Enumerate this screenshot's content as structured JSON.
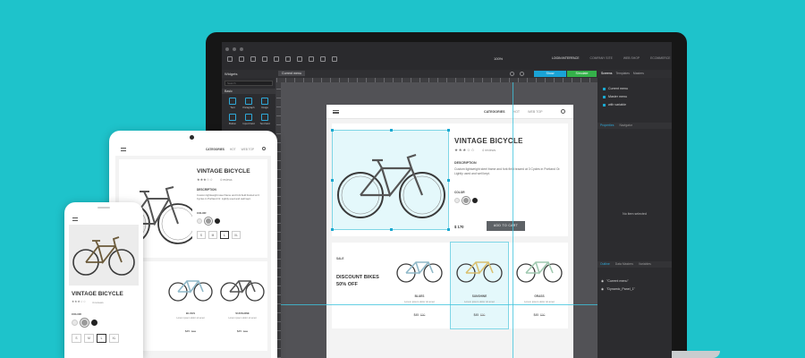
{
  "editor": {
    "zoom": "100%",
    "top_menu": [
      "LOGIN INTERFACE",
      "COMPANY SITE",
      "WEB SHOP",
      "ECOMMERCE"
    ],
    "widgets_title": "Widgets",
    "search_placeholder": "Search",
    "category": "Basic",
    "current_tab": "Current menu",
    "widgets": [
      "Text",
      "Paragraph",
      "Image",
      "Button",
      "Input Field",
      "Text field"
    ],
    "show_button": "Show",
    "simulate_button": "Simulate",
    "right_tabs": [
      "Screens",
      "Templates",
      "Masters"
    ],
    "screens": [
      "Current menu",
      "Master menu",
      "with variable"
    ],
    "properties_tabs": [
      "Properties",
      "Navigator"
    ],
    "no_item": "No item selected",
    "outline_tabs": [
      "Outline",
      "Data Masters",
      "Variables"
    ],
    "outline_items": [
      "\"Current menu\"",
      "\"Dynamic_Panel_1\""
    ]
  },
  "shop": {
    "nav": [
      "CATEGORIES",
      "HOT",
      "WEB TOP"
    ],
    "title": "VINTAGE BICYCLE",
    "stars": "★★★☆☆",
    "reviews": "4 reviews",
    "description_label": "DESCRIPTION",
    "description": "Custom lightweight steel frame and fork field brazed at 3 Cycles in Portland Or. Lightly used and well kept.",
    "color_label": "COLOR",
    "colors": [
      "#e8e8e8",
      "#9a9a9a",
      "#222222"
    ],
    "price": "$ 170",
    "add_to_cart": "ADD TO CART",
    "sizes": [
      "S",
      "M",
      "L",
      "XL"
    ],
    "sale_label": "SALE",
    "discount_title": "DISCOUNT BIKES 50% OFF",
    "discount_title_short": "BIKES",
    "products": [
      {
        "name": "BLUES",
        "sub": "Lorem ipsum dolor sit amet",
        "price": "$45",
        "old": "$90",
        "color": "#8fb8c8"
      },
      {
        "name": "SUNSHINE",
        "sub": "Lorem ipsum dolor sit amet",
        "price": "$45",
        "old": "$90",
        "color": "#e8dca8"
      },
      {
        "name": "GRASS",
        "sub": "Lorem ipsum dolor sit amet",
        "price": "$45",
        "old": "$90",
        "color": "#9fc8b0"
      }
    ]
  },
  "tablet_products": [
    {
      "name": "BLUES",
      "sub": "Lorem ipsum dolor sit amet",
      "price": "$45",
      "old": "$90",
      "color": "#8fb8c8"
    },
    {
      "name": "SUNSHINE",
      "sub": "Lorem ipsum dolor sit amet",
      "price": "$45",
      "old": "$90",
      "color": "#8a8a8a"
    }
  ]
}
